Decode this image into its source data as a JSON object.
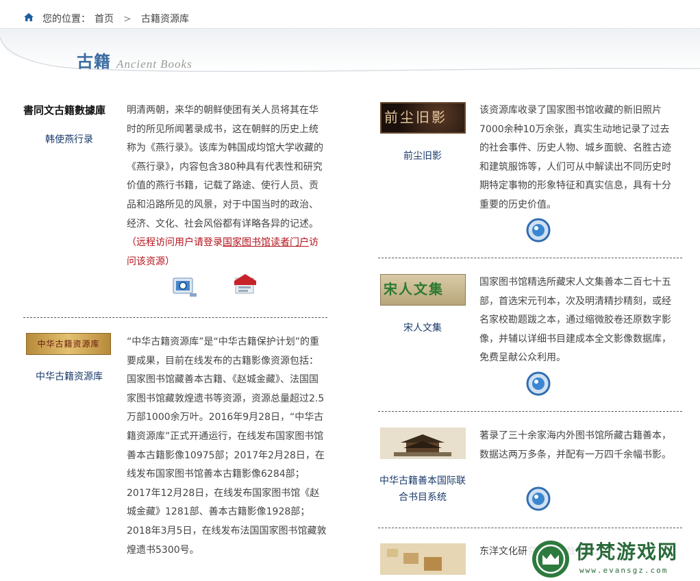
{
  "breadcrumb": {
    "prefix": "您的位置：",
    "home": "首页",
    "separator": ">",
    "current": "古籍资源库"
  },
  "banner": {
    "title_cn": "古籍",
    "title_en": "Ancient Books"
  },
  "left": [
    {
      "logo_text": "書同文古籍數據庫",
      "title": "韩使燕行录",
      "desc": "明清两朝，来华的朝鲜使团有关人员将其在华时的所见所闻著录成书，这在朝鲜的历史上统称为《燕行录》。该库为韩国成均馆大学收藏的《燕行录》，内容包含380种具有代表性和研究价值的燕行书籍，记载了路途、使行人员、贡品和沿路所见的风景，对于中国当时的政治、经济、文化、社会风俗都有详略各异的记述。",
      "note_pre": "（远程访问用户请登录",
      "note_link": "国家图书馆读者门户",
      "note_post": "访问该资源）"
    },
    {
      "logo_text": "中华古籍资源库",
      "title": "中华古籍资源库",
      "desc": "“中华古籍资源库”是“中华古籍保护计划”的重要成果，目前在线发布的古籍影像资源包括：国家图书馆藏善本古籍、《赵城金藏》、法国国家图书馆藏敦煌遗书等资源，资源总量超过2.5万部1000余万叶。2016年9月28日，“中华古籍资源库”正式开通运行，在线发布国家图书馆善本古籍影像10975部；2017年2月28日，在线发布国家图书馆善本古籍影像6284部；2017年12月28日，在线发布国家图书馆《赵城金藏》1281部、善本古籍影像1928部；2018年3月5日，在线发布法国国家图书馆藏敦煌遗书5300号。"
    }
  ],
  "right": [
    {
      "logo_text": "前尘旧影",
      "title": "前尘旧影",
      "desc": "该资源库收录了国家图书馆收藏的新旧照片7000余种10万余张，真实生动地记录了过去的社会事件、历史人物、城乡面貌、名胜古迹和建筑服饰等，人们可从中解读出不同历史时期特定事物的形象特征和真实信息，具有十分重要的历史价值。"
    },
    {
      "logo_text": "宋人文集",
      "title": "宋人文集",
      "desc": "国家图书馆精选所藏宋人文集善本二百七十五部，首选宋元刊本，次及明清精抄精刻，或经名家校勘题跋之本，通过缩微胶卷还原数字影像，并辅以详细书目建成本全文影像数据库，免费呈献公众利用。"
    },
    {
      "title": "中华古籍善本国际联合书目系统",
      "desc": "著录了三十余家海内外图书馆所藏古籍善本，数据达两万多条，并配有一万四千余幅书影。"
    },
    {
      "desc": "东洋文化研究所…以数字化方…"
    }
  ],
  "watermark": {
    "text": "伊梵游戏网",
    "url": "www.evansgz.com"
  },
  "colors": {
    "link": "#1a3a6a",
    "accent_red": "#b3121b",
    "banner_blue": "#3a6aa0"
  }
}
